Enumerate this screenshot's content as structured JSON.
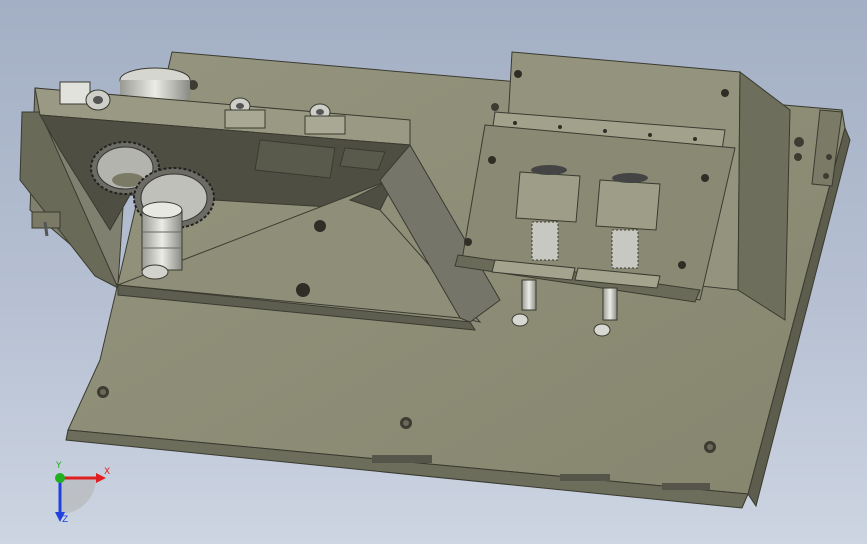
{
  "viewport": {
    "background_top": "#a3afc4",
    "background_bottom": "#cdd5e2"
  },
  "model": {
    "body_color": "#8c8c78",
    "shadow_color": "#5e5e50",
    "metal_color": "#d8d8d2"
  },
  "triad": {
    "x_label": "X",
    "y_label": "Y",
    "z_label": "Z",
    "x_color": "#e02020",
    "y_color": "#20b020",
    "z_color": "#2040e0"
  }
}
